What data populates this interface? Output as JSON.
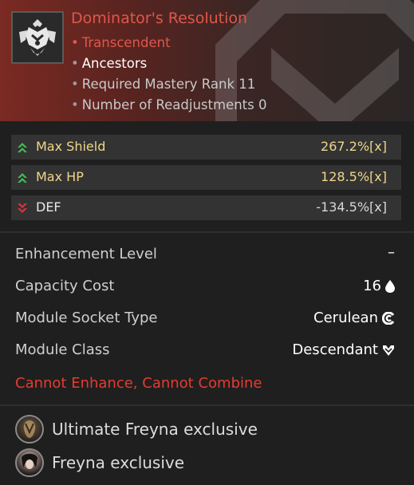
{
  "module": {
    "name": "Dominator's Resolution",
    "tier": "Transcendent",
    "class": "Ancestors",
    "required_mastery": "Required Mastery Rank 11",
    "readjustments": "Number of Readjustments 0"
  },
  "stats": [
    {
      "label": "Max Shield",
      "value": "267.2%[x]",
      "direction": "up"
    },
    {
      "label": "Max HP",
      "value": "128.5%[x]",
      "direction": "up"
    },
    {
      "label": "DEF",
      "value": "-134.5%[x]",
      "direction": "down"
    }
  ],
  "info": {
    "enhancement_label": "Enhancement Level",
    "enhancement_value": "–",
    "capacity_label": "Capacity Cost",
    "capacity_value": "16",
    "socket_label": "Module Socket Type",
    "socket_value": "Cerulean",
    "class_label": "Module Class",
    "class_value": "Descendant"
  },
  "warning": "Cannot Enhance, Cannot Combine",
  "exclusives": [
    {
      "label": "Ultimate Freyna exclusive"
    },
    {
      "label": "Freyna exclusive"
    }
  ],
  "colors": {
    "title_red": "#e0574a",
    "stat_gold": "#f0d68a",
    "arrow_up": "#3fbf55",
    "arrow_down": "#d9353a",
    "warning_red": "#e63b30"
  },
  "icons": {
    "module": "module-icon",
    "up": "double-chevron-up-icon",
    "down": "double-chevron-down-icon",
    "capacity": "droplet-icon",
    "socket": "cerulean-socket-icon",
    "class": "descendant-class-icon",
    "emblem": "descendant-emblem-watermark"
  }
}
